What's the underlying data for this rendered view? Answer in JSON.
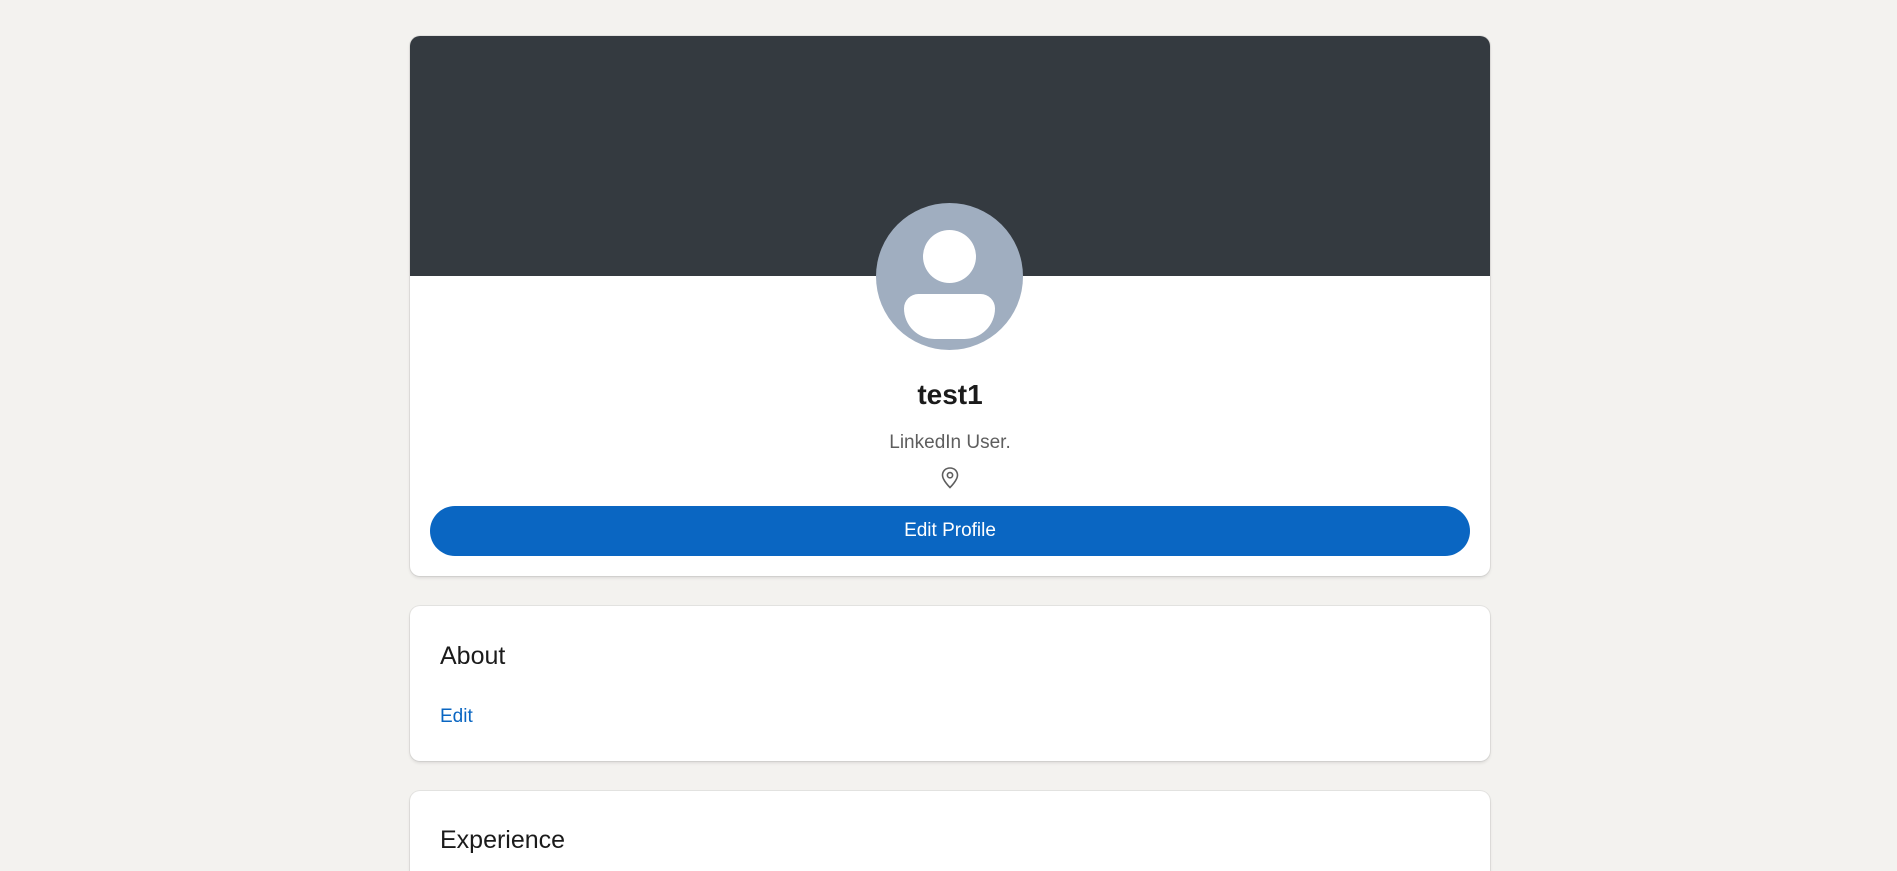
{
  "profile": {
    "name": "test1",
    "headline": "LinkedIn User.",
    "location": "",
    "edit_profile_label": "Edit Profile",
    "banner_color": "#343a40",
    "avatar_color": "#a0aec0",
    "accent_color": "#0a66c2"
  },
  "about": {
    "title": "About",
    "edit_label": "Edit"
  },
  "experience": {
    "title": "Experience"
  },
  "icons": {
    "location": "map-pin-icon",
    "avatar": "user-placeholder-icon"
  }
}
